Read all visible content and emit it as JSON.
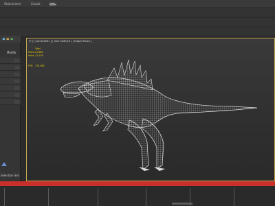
{
  "menu": {
    "item1": "Objectname",
    "item2": "Zusatz"
  },
  "left_panel": {
    "label": "Modify",
    "footer": "Selection Set:"
  },
  "viewport": {
    "label": "[+] [ Camera001 ] [ User Defined ] [ Edged Faces ]",
    "stats": {
      "title": "Total",
      "polys_label": "Polys:",
      "polys_value": "21,880",
      "verts_label": "Verts:",
      "verts_value": "11,139",
      "fps_label": "FPS:",
      "fps_value": "175.985"
    }
  },
  "colors": {
    "accent_border": "#c8a850",
    "timeline_bar": "#c8302c",
    "stats_text": "#f0d000",
    "wireframe": "#e8e8e8"
  }
}
